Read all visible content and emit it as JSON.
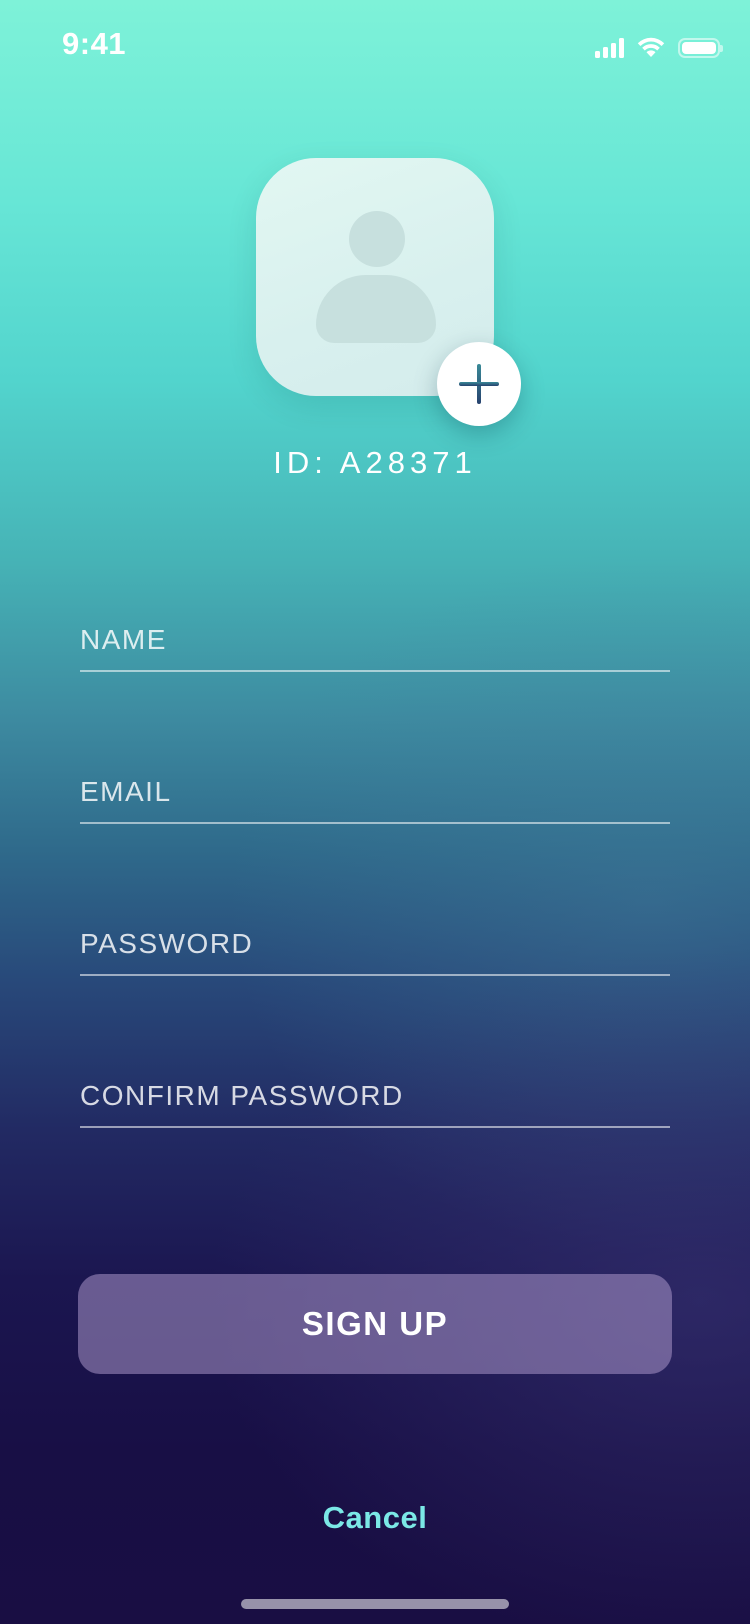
{
  "status_bar": {
    "time": "9:41",
    "signal_icon": "cellular-signal-icon",
    "wifi_icon": "wifi-icon",
    "battery_icon": "battery-icon"
  },
  "profile": {
    "avatar_icon": "person-placeholder-icon",
    "add_photo_icon": "plus-icon",
    "id_label": "ID: A28371"
  },
  "form": {
    "name_placeholder": "NAME",
    "email_placeholder": "EMAIL",
    "password_placeholder": "PASSWORD",
    "confirm_password_placeholder": "CONFIRM PASSWORD"
  },
  "actions": {
    "signup_label": "SIGN UP",
    "cancel_label": "Cancel"
  },
  "colors": {
    "gradient_top": "#7ef2d8",
    "gradient_bottom": "#190e43",
    "cancel_text": "#7be8e6",
    "plus_icon": "#2f6480"
  }
}
